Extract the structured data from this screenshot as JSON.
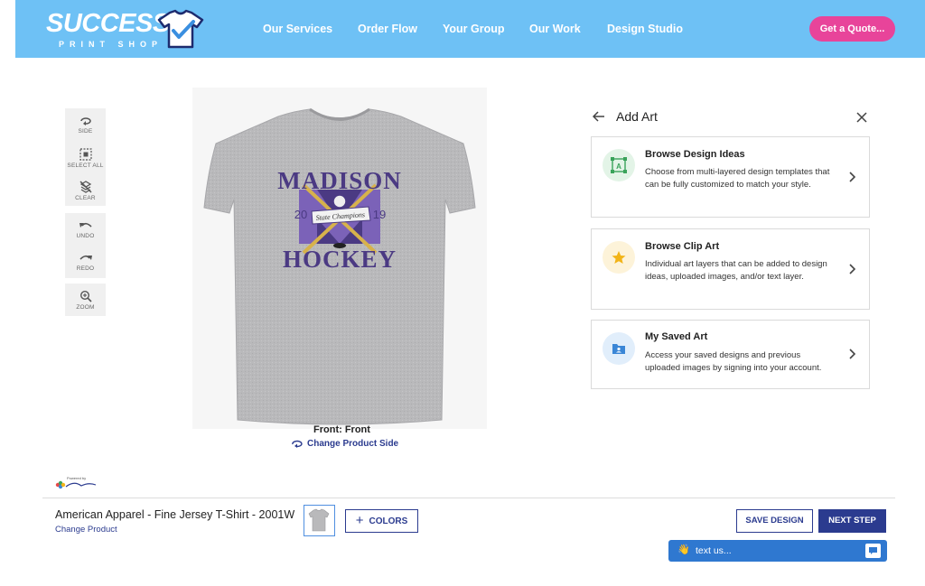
{
  "header": {
    "logo_word": "SUCCESS",
    "logo_sub": "PRINT SHOP",
    "nav": [
      "Our Services",
      "Order Flow",
      "Your Group",
      "Our Work",
      "Design Studio"
    ],
    "quote_button": "Get a Quote...",
    "bg_color": "#6ec1f5",
    "accent_color": "#e8449a"
  },
  "toolbar": {
    "side": "SIDE",
    "select_all": "SELECT ALL",
    "clear": "CLEAR",
    "undo": "UNDO",
    "redo": "REDO",
    "zoom": "ZOOM"
  },
  "design": {
    "line1": "MADISON",
    "line2": "HOCKEY",
    "year_left": "20",
    "year_right": "19",
    "banner": "State Champions",
    "side_label": "Front: Front",
    "change_side": "Change Product Side"
  },
  "panel": {
    "title": "Add Art",
    "cards": [
      {
        "title": "Browse Design Ideas",
        "desc": "Choose from multi-layered design templates that can be fully customized to match your style.",
        "icon": "design-ideas-icon"
      },
      {
        "title": "Browse Clip Art",
        "desc": "Individual art layers that can be added to design ideas, uploaded images, and/or text layer.",
        "icon": "star-icon"
      },
      {
        "title": "My Saved Art",
        "desc": "Access your saved designs and previous uploaded images by signing into your account.",
        "icon": "folder-user-icon"
      }
    ]
  },
  "footer": {
    "powered": "Powered by",
    "product_name": "American Apparel - Fine Jersey T-Shirt - 2001W",
    "change_product": "Change Product",
    "colors_button": "COLORS",
    "save_button": "SAVE DESIGN",
    "next_button": "NEXT STEP",
    "textus": "text us...",
    "primary_color": "#2b3b8f"
  }
}
